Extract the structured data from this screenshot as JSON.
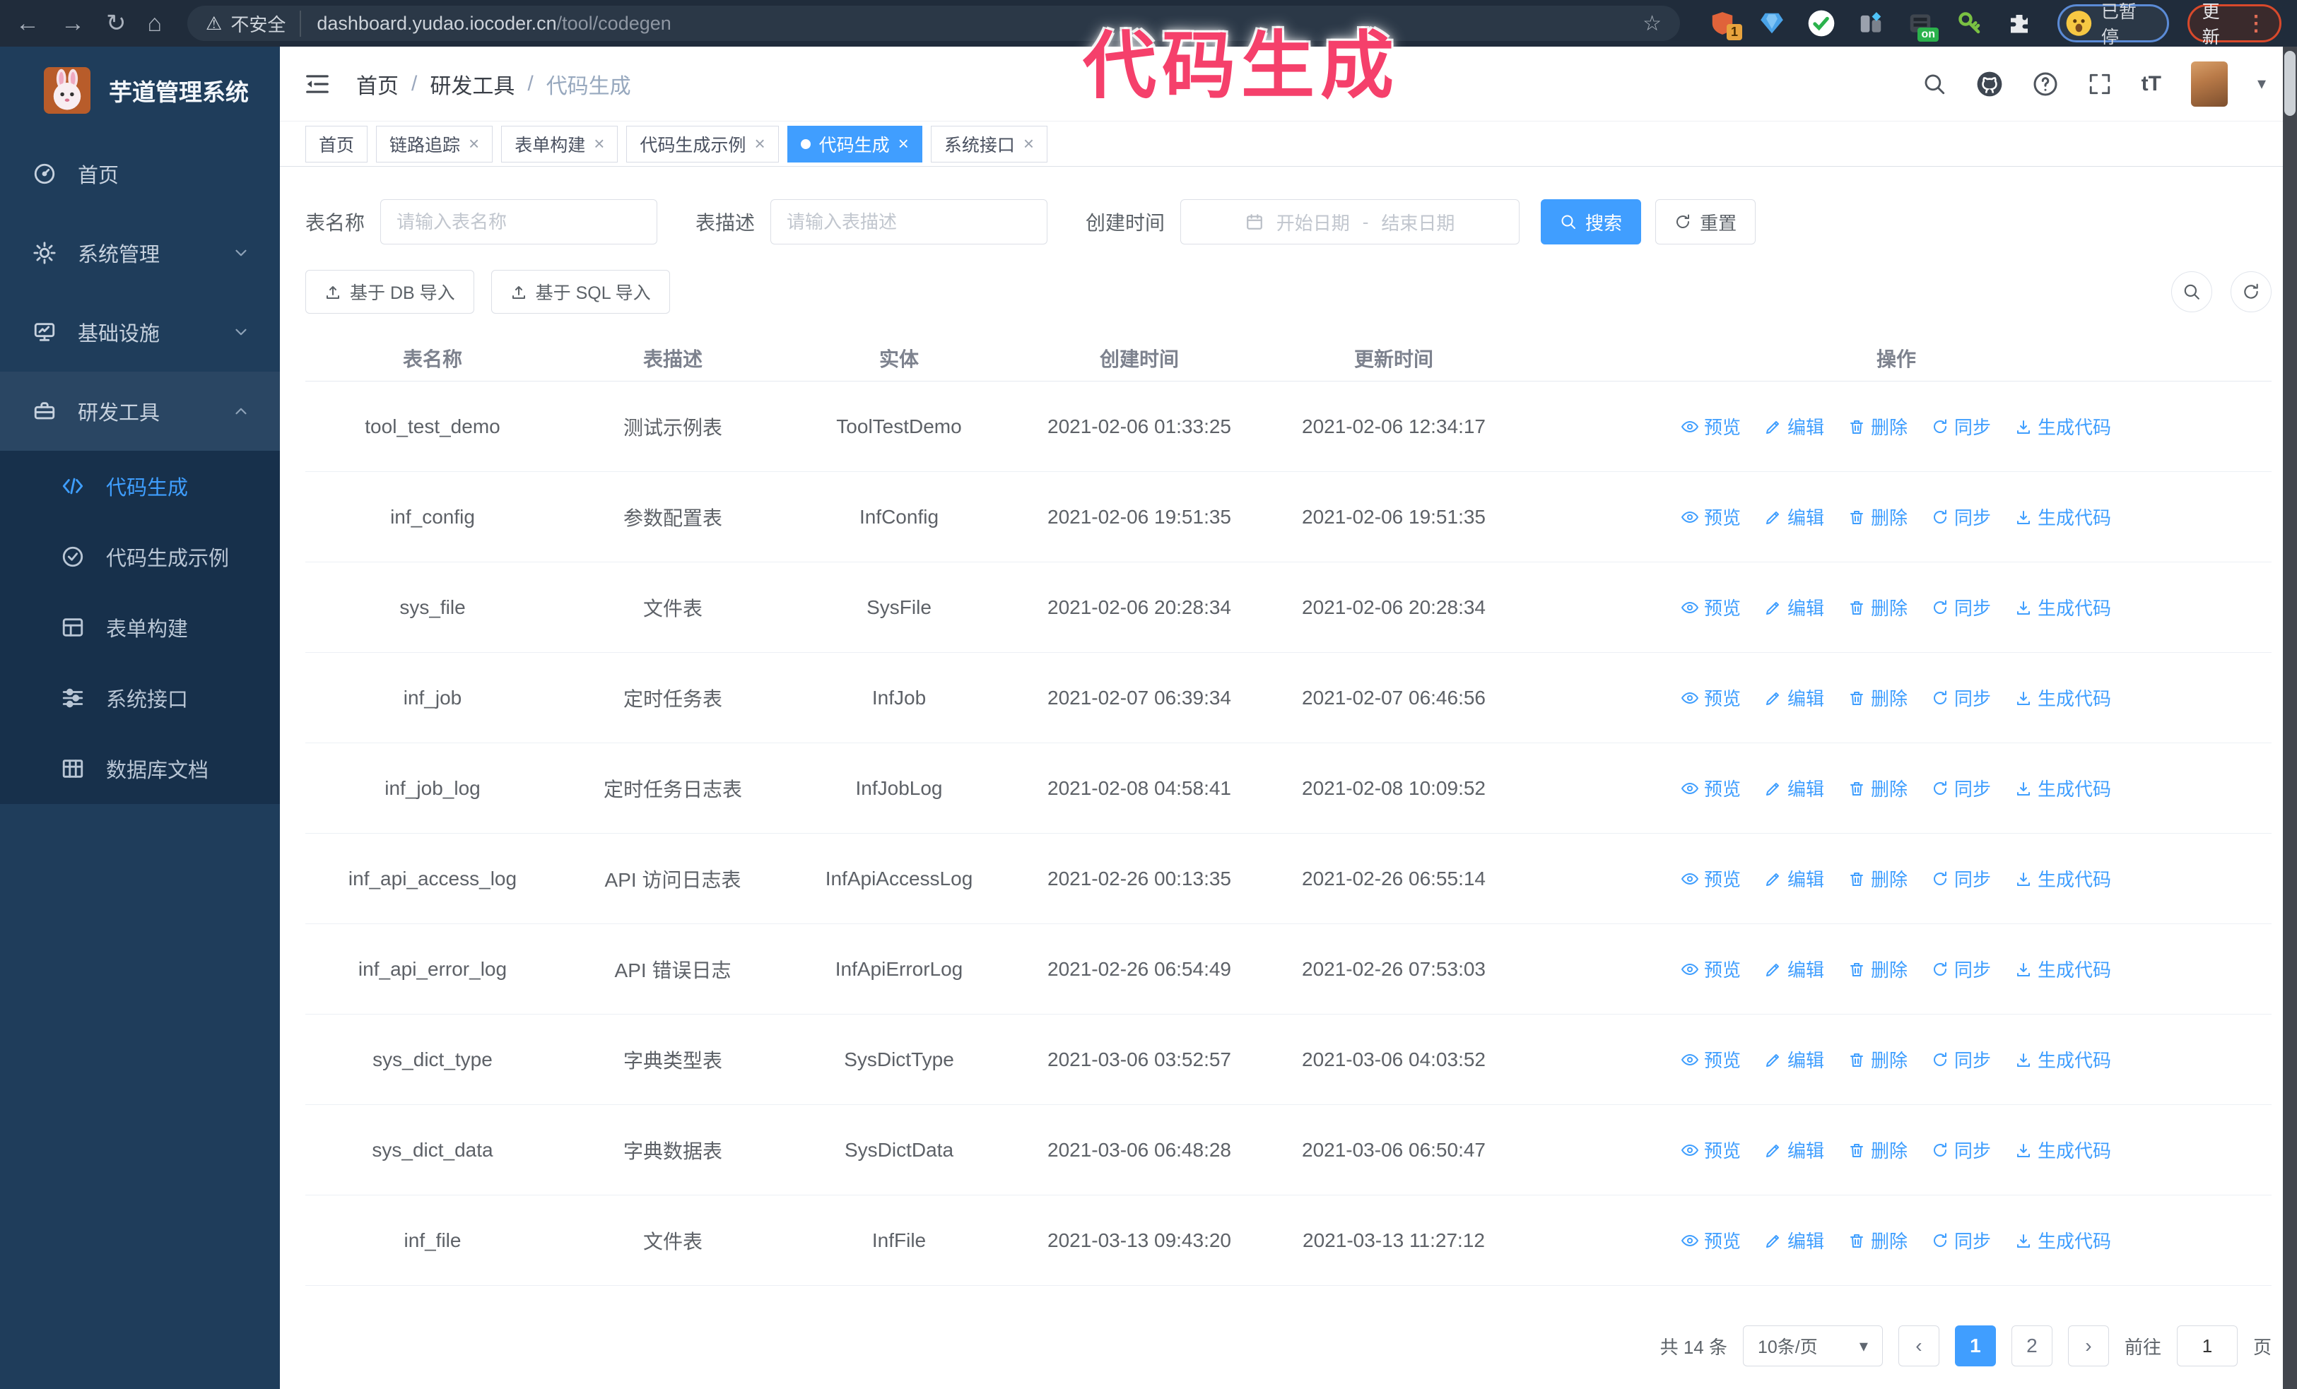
{
  "colors": {
    "accent": "#409eff",
    "annotation_pink": "#f5406b",
    "sidebar_bg": "#1f3d5b",
    "chrome_bg": "#202c3b"
  },
  "icons": {
    "back": "←",
    "forward": "→",
    "reload": "↻",
    "home": "⌂",
    "warning": "⚠",
    "star": "☆",
    "menu_dots": "⋮",
    "caret_down": "▾",
    "tab_close": "×",
    "font_size": "tT"
  },
  "chrome": {
    "security_label": "不安全",
    "url_host": "dashboard.yudao.iocoder.cn",
    "url_path": "/tool/codegen",
    "extension_badge": "1",
    "extension_on_badge": "on",
    "profile_label": "已暂停",
    "update_label": "更新"
  },
  "annotation": {
    "text": "代码生成"
  },
  "sidebar": {
    "title": "芋道管理系统",
    "items": [
      {
        "label": "首页"
      },
      {
        "label": "系统管理"
      },
      {
        "label": "基础设施"
      },
      {
        "label": "研发工具"
      }
    ],
    "sub_items": [
      {
        "label": "代码生成",
        "active": true
      },
      {
        "label": "代码生成示例",
        "active": false
      },
      {
        "label": "表单构建",
        "active": false
      },
      {
        "label": "系统接口",
        "active": false
      },
      {
        "label": "数据库文档",
        "active": false
      }
    ]
  },
  "header": {
    "breadcrumb": [
      "首页",
      "研发工具",
      "代码生成"
    ]
  },
  "tabs": [
    {
      "label": "首页",
      "closable": false,
      "active": false
    },
    {
      "label": "链路追踪",
      "closable": true,
      "active": false
    },
    {
      "label": "表单构建",
      "closable": true,
      "active": false
    },
    {
      "label": "代码生成示例",
      "closable": true,
      "active": false
    },
    {
      "label": "代码生成",
      "closable": true,
      "active": true
    },
    {
      "label": "系统接口",
      "closable": true,
      "active": false
    }
  ],
  "filters": {
    "name_label": "表名称",
    "name_placeholder": "请输入表名称",
    "desc_label": "表描述",
    "desc_placeholder": "请输入表描述",
    "time_label": "创建时间",
    "start_placeholder": "开始日期",
    "range_separator": "-",
    "end_placeholder": "结束日期",
    "search_label": "搜索",
    "reset_label": "重置"
  },
  "toolbar": {
    "db_import_label": "基于 DB 导入",
    "sql_import_label": "基于 SQL 导入"
  },
  "table": {
    "columns": [
      "表名称",
      "表描述",
      "实体",
      "创建时间",
      "更新时间",
      "操作"
    ],
    "ops": [
      "预览",
      "编辑",
      "删除",
      "同步",
      "生成代码"
    ],
    "rows": [
      {
        "name": "tool_test_demo",
        "desc": "测试示例表",
        "entity": "ToolTestDemo",
        "created": "2021-02-06 01:33:25",
        "updated": "2021-02-06 12:34:17"
      },
      {
        "name": "inf_config",
        "desc": "参数配置表",
        "entity": "InfConfig",
        "created": "2021-02-06 19:51:35",
        "updated": "2021-02-06 19:51:35"
      },
      {
        "name": "sys_file",
        "desc": "文件表",
        "entity": "SysFile",
        "created": "2021-02-06 20:28:34",
        "updated": "2021-02-06 20:28:34"
      },
      {
        "name": "inf_job",
        "desc": "定时任务表",
        "entity": "InfJob",
        "created": "2021-02-07 06:39:34",
        "updated": "2021-02-07 06:46:56"
      },
      {
        "name": "inf_job_log",
        "desc": "定时任务日志表",
        "entity": "InfJobLog",
        "created": "2021-02-08 04:58:41",
        "updated": "2021-02-08 10:09:52"
      },
      {
        "name": "inf_api_access_log",
        "desc": "API 访问日志表",
        "entity": "InfApiAccessLog",
        "created": "2021-02-26 00:13:35",
        "updated": "2021-02-26 06:55:14"
      },
      {
        "name": "inf_api_error_log",
        "desc": "API 错误日志",
        "entity": "InfApiErrorLog",
        "created": "2021-02-26 06:54:49",
        "updated": "2021-02-26 07:53:03"
      },
      {
        "name": "sys_dict_type",
        "desc": "字典类型表",
        "entity": "SysDictType",
        "created": "2021-03-06 03:52:57",
        "updated": "2021-03-06 04:03:52"
      },
      {
        "name": "sys_dict_data",
        "desc": "字典数据表",
        "entity": "SysDictData",
        "created": "2021-03-06 06:48:28",
        "updated": "2021-03-06 06:50:47"
      },
      {
        "name": "inf_file",
        "desc": "文件表",
        "entity": "InfFile",
        "created": "2021-03-13 09:43:20",
        "updated": "2021-03-13 11:27:12"
      }
    ]
  },
  "pagination": {
    "total_label": "共 14 条",
    "page_size_label": "10条/页",
    "pages": [
      {
        "label": "1",
        "active": true
      },
      {
        "label": "2",
        "active": false
      }
    ],
    "goto_label": "前往",
    "goto_value": "1",
    "page_suffix_label": "页"
  }
}
